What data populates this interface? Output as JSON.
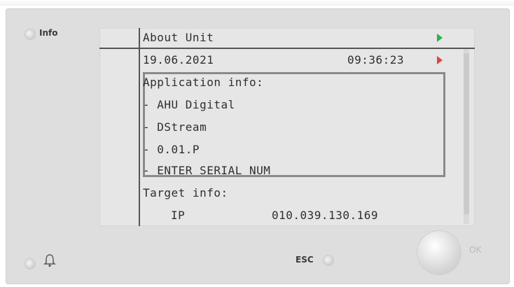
{
  "hardware": {
    "info_label": "Info",
    "esc_label": "ESC",
    "ok_label": "OK"
  },
  "screen": {
    "header_title": "About Unit",
    "date": "19.06.2021",
    "time": "09:36:23",
    "application_heading": "Application info:",
    "application_items": [
      "- AHU Digital",
      "- DStream",
      "- 0.01.P",
      "- ENTER SERIAL NUM"
    ],
    "target_heading": "Target info:",
    "ip_label": "IP",
    "ip_value": "010.039.130.169"
  },
  "colors": {
    "header_arrow": "#2bb34a",
    "time_arrow": "#e0453a"
  },
  "icons": {
    "bell": "bell-icon",
    "header_arrow": "triangle-right-icon",
    "time_arrow": "triangle-right-icon"
  }
}
